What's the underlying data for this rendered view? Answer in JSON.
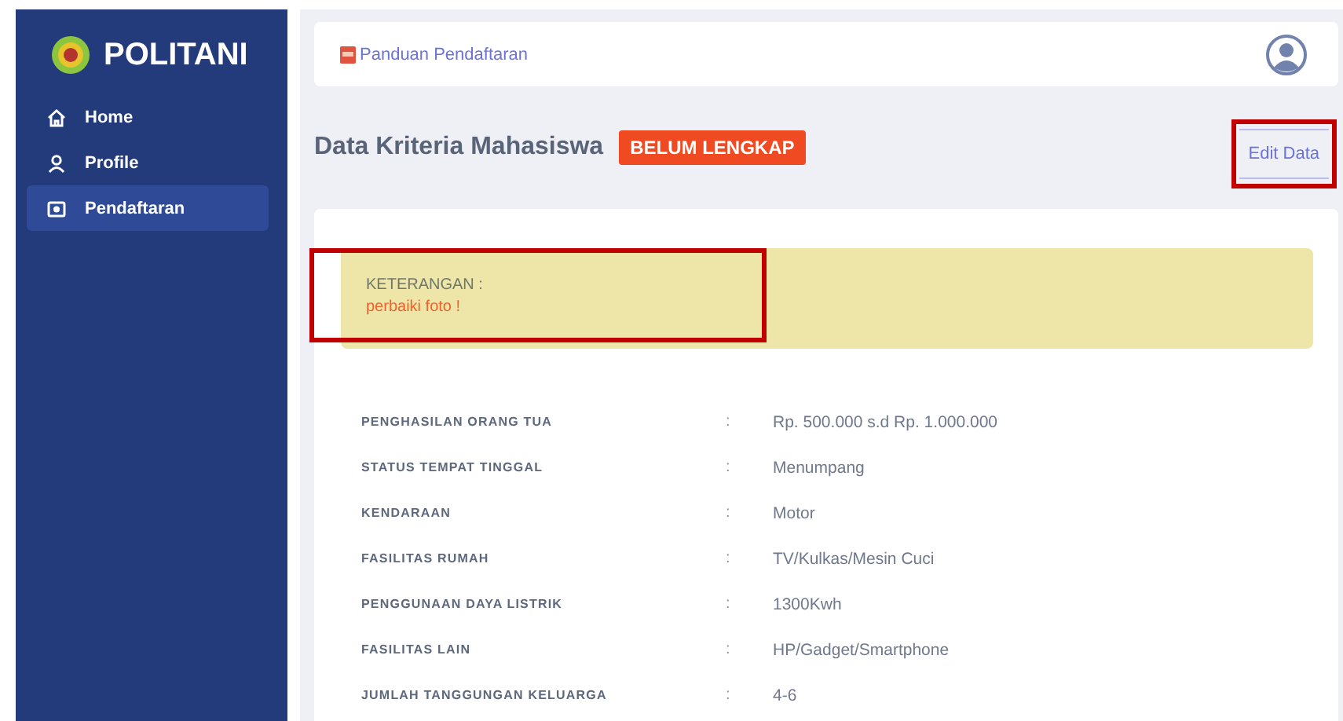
{
  "brand": {
    "name": "POLITANI"
  },
  "sidebar": {
    "items": [
      {
        "label": "Home",
        "selected": false
      },
      {
        "label": "Profile",
        "selected": false
      },
      {
        "label": "Pendaftaran",
        "selected": true
      }
    ]
  },
  "header": {
    "link": "Panduan Pendaftaran"
  },
  "page": {
    "title": "Data Kriteria Mahasiswa",
    "badge": "BELUM LENGKAP",
    "edit_button": "Edit Data"
  },
  "notice": {
    "title": "KETERANGAN :",
    "message": "perbaiki foto !"
  },
  "details": [
    {
      "label": "PENGHASILAN ORANG TUA",
      "value": "Rp. 500.000 s.d Rp. 1.000.000"
    },
    {
      "label": "STATUS TEMPAT TINGGAL",
      "value": "Menumpang"
    },
    {
      "label": "KENDARAAN",
      "value": "Motor"
    },
    {
      "label": "FASILITAS RUMAH",
      "value": "TV/Kulkas/Mesin Cuci"
    },
    {
      "label": "PENGGUNAAN DAYA LISTRIK",
      "value": "1300Kwh"
    },
    {
      "label": "FASILITAS LAIN",
      "value": "HP/Gadget/Smartphone"
    },
    {
      "label": "JUMLAH TANGGUNGAN KELUARGA",
      "value": "4-6"
    }
  ],
  "separator": ":"
}
